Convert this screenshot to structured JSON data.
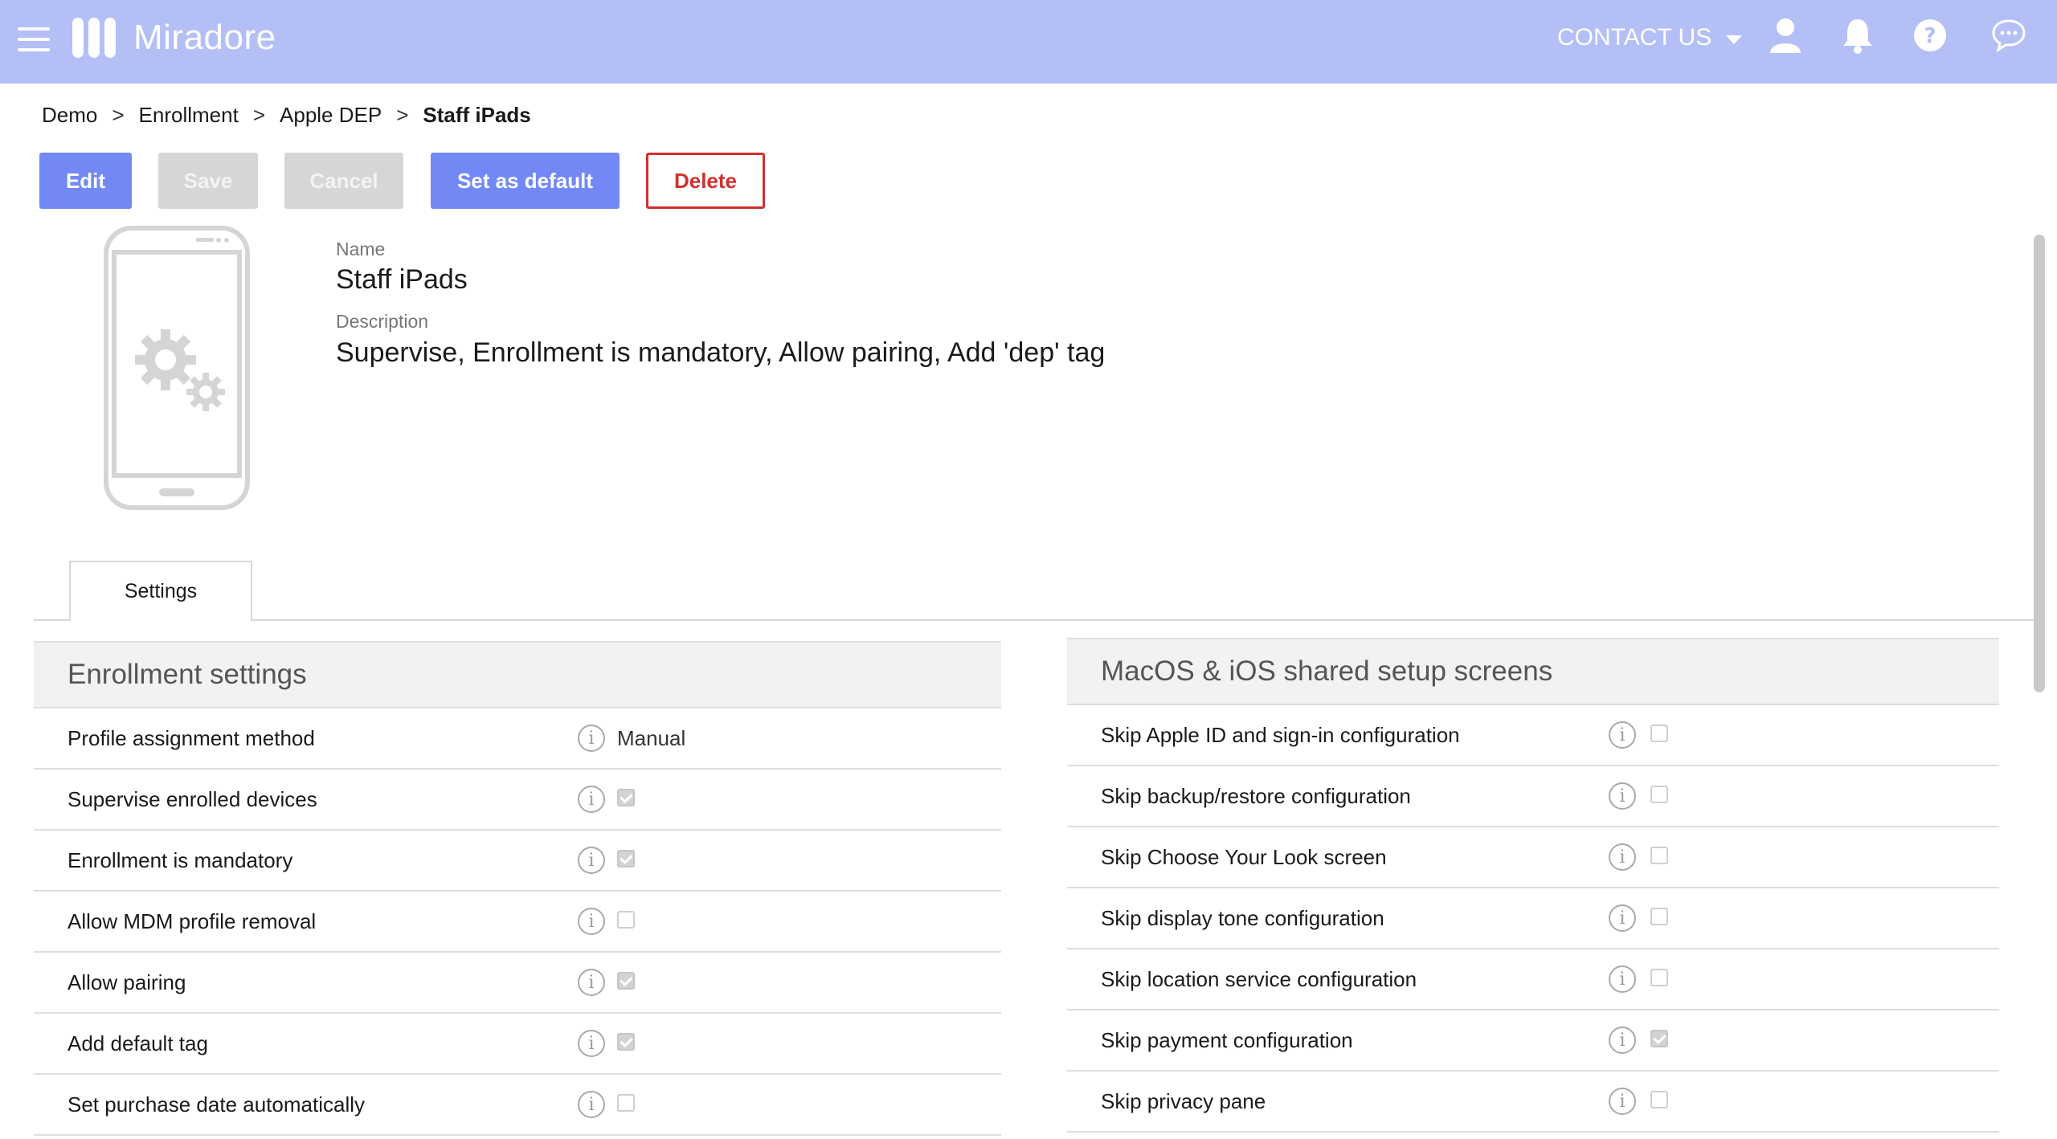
{
  "header": {
    "brand": "Miradore",
    "contact_label": "CONTACT US",
    "color": "#b3bff5"
  },
  "breadcrumb": {
    "items": [
      "Demo",
      "Enrollment",
      "Apple DEP"
    ],
    "current": "Staff iPads",
    "separator": ">"
  },
  "toolbar": {
    "edit": "Edit",
    "save": "Save",
    "cancel": "Cancel",
    "set_default": "Set as default",
    "delete": "Delete"
  },
  "profile": {
    "name_label": "Name",
    "name": "Staff iPads",
    "description_label": "Description",
    "description": "Supervise, Enrollment is mandatory, Allow pairing, Add 'dep' tag"
  },
  "tabs": [
    {
      "label": "Settings",
      "active": true
    }
  ],
  "enrollment_settings": {
    "title": "Enrollment settings",
    "rows": [
      {
        "label": "Profile assignment method",
        "value": "Manual"
      },
      {
        "label": "Supervise enrolled devices",
        "checked": true
      },
      {
        "label": "Enrollment is mandatory",
        "checked": true
      },
      {
        "label": "Allow MDM profile removal",
        "checked": false
      },
      {
        "label": "Allow pairing",
        "checked": true
      },
      {
        "label": "Add default tag",
        "checked": true
      },
      {
        "label": "Set purchase date automatically",
        "checked": false
      }
    ]
  },
  "setup_screens": {
    "title": "MacOS & iOS shared setup screens",
    "rows": [
      {
        "label": "Skip Apple ID and sign-in configuration",
        "checked": false
      },
      {
        "label": "Skip backup/restore configuration",
        "checked": false
      },
      {
        "label": "Skip Choose Your Look screen",
        "checked": false
      },
      {
        "label": "Skip display tone configuration",
        "checked": false
      },
      {
        "label": "Skip location service configuration",
        "checked": false
      },
      {
        "label": "Skip payment configuration",
        "checked": true
      },
      {
        "label": "Skip privacy pane",
        "checked": false
      }
    ]
  },
  "icons": {
    "info": "i"
  }
}
